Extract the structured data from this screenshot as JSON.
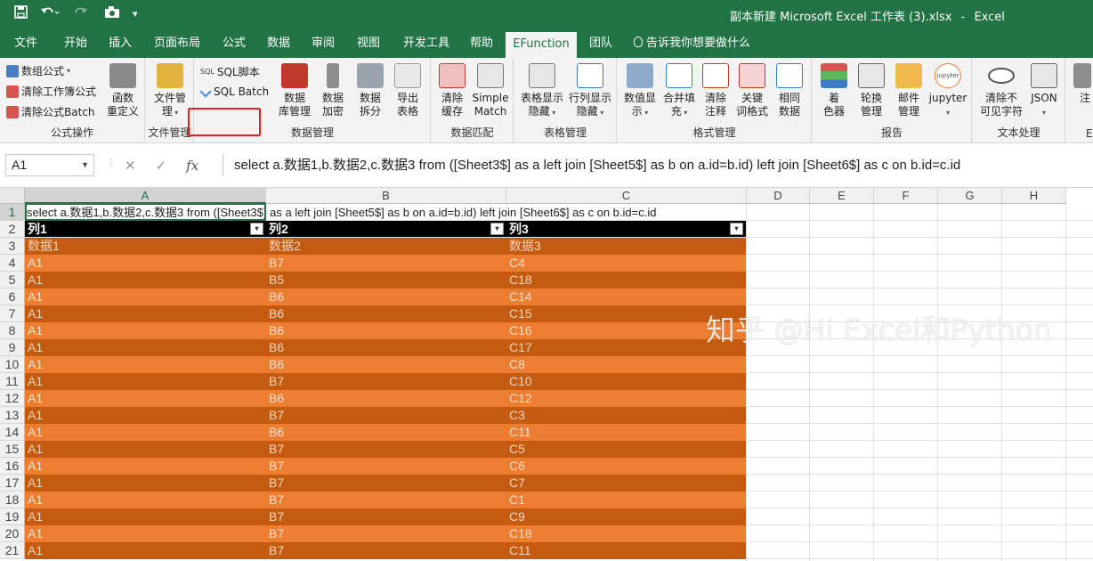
{
  "window": {
    "title": "副本新建 Microsoft Excel 工作表 (3).xlsx",
    "app": "Excel"
  },
  "qat": {
    "save_icon": "save-icon",
    "undo_icon": "undo-icon",
    "redo_icon": "redo-icon",
    "camera_icon": "camera-icon",
    "more": "▾"
  },
  "tabs": [
    {
      "label": "文件"
    },
    {
      "label": "开始"
    },
    {
      "label": "插入"
    },
    {
      "label": "页面布局"
    },
    {
      "label": "公式"
    },
    {
      "label": "数据"
    },
    {
      "label": "审阅"
    },
    {
      "label": "视图"
    },
    {
      "label": "开发工具"
    },
    {
      "label": "帮助"
    },
    {
      "label": "EFunction"
    },
    {
      "label": "团队"
    }
  ],
  "tell_me": "告诉我你想要做什么",
  "ribbon": {
    "formula_ops": {
      "items": [
        "数组公式",
        "清除工作簿公式",
        "清除公式Batch"
      ],
      "big": "函数\n重定义",
      "label": "公式操作"
    },
    "file_mgmt": {
      "big": "文件管\n理",
      "label": "文件管理"
    },
    "sql": {
      "script": "SQL脚本",
      "batch": "SQL Batch",
      "sql_tag": "SQL"
    },
    "data_mgmt": {
      "items": [
        "数据\n库管理",
        "数据\n加密",
        "数据\n拆分",
        "导出\n表格"
      ],
      "label": "数据管理"
    },
    "data_match": {
      "items": [
        "清除\n缓存",
        "Simple\nMatch"
      ],
      "label": "数据匹配"
    },
    "table_mgmt": {
      "items": [
        "表格显示\n隐藏",
        "行列显示\n隐藏"
      ],
      "label": "表格管理"
    },
    "format_mgmt": {
      "items": [
        "数值显\n示",
        "合并填\n充",
        "清除\n注释",
        "关键\n词格式",
        "相同\n数据"
      ],
      "label": "格式管理"
    },
    "report": {
      "items": [
        "着\n色器",
        "轮换\n管理",
        "邮件\n管理",
        "jupyter"
      ],
      "jupyter_logo": "jupyter",
      "label": "报告"
    },
    "text_proc": {
      "items": [
        "清除不\n可见字符",
        "JSON"
      ],
      "label": "文本处理"
    },
    "cut": {
      "item": "注",
      "label": "E"
    }
  },
  "formula_bar": {
    "name_box": "A1",
    "cancel": "✕",
    "enter": "✓",
    "fx": "fx",
    "formula": "select a.数据1,b.数据2,c.数据3 from ([Sheet3$] as a left join [Sheet5$] as b  on a.id=b.id) left join [Sheet6$] as c on b.id=c.id"
  },
  "columns": [
    "A",
    "B",
    "C",
    "D",
    "E",
    "F",
    "G",
    "H"
  ],
  "row_numbers": [
    "1",
    "2",
    "3",
    "4",
    "5",
    "6",
    "7",
    "8",
    "9",
    "10",
    "11",
    "12",
    "13",
    "14",
    "15",
    "16",
    "17",
    "18",
    "19",
    "20",
    "21"
  ],
  "sheet": {
    "a1": "select a.数据1,b.数据2,c.数据3 from ([Sheet3$] as a left join [Sheet5$] as b  on a.id=b.id) left join [Sheet6$] as c on b.id=c.id",
    "header": [
      "列1",
      "列2",
      "列3"
    ],
    "filter_glyph": "▾",
    "rows": [
      [
        "数据1",
        "数据2",
        "数据3"
      ],
      [
        "A1",
        "B7",
        "C4"
      ],
      [
        "A1",
        "B5",
        "C18"
      ],
      [
        "A1",
        "B6",
        "C14"
      ],
      [
        "A1",
        "B6",
        "C15"
      ],
      [
        "A1",
        "B6",
        "C16"
      ],
      [
        "A1",
        "B6",
        "C17"
      ],
      [
        "A1",
        "B6",
        "C8"
      ],
      [
        "A1",
        "B7",
        "C10"
      ],
      [
        "A1",
        "B6",
        "C12"
      ],
      [
        "A1",
        "B7",
        "C3"
      ],
      [
        "A1",
        "B6",
        "C11"
      ],
      [
        "A1",
        "B7",
        "C5"
      ],
      [
        "A1",
        "B7",
        "C6"
      ],
      [
        "A1",
        "B7",
        "C7"
      ],
      [
        "A1",
        "B7",
        "C1"
      ],
      [
        "A1",
        "B7",
        "C9"
      ],
      [
        "A1",
        "B7",
        "C18"
      ],
      [
        "A1",
        "B7",
        "C11"
      ]
    ]
  },
  "watermark": "知乎 @Hi Excel和Python",
  "colors": {
    "excel_green": "#217346",
    "band_dark": "#c55a11",
    "band_light": "#ed7d31",
    "header_black": "#000000",
    "highlight_red": "#e0241b"
  }
}
